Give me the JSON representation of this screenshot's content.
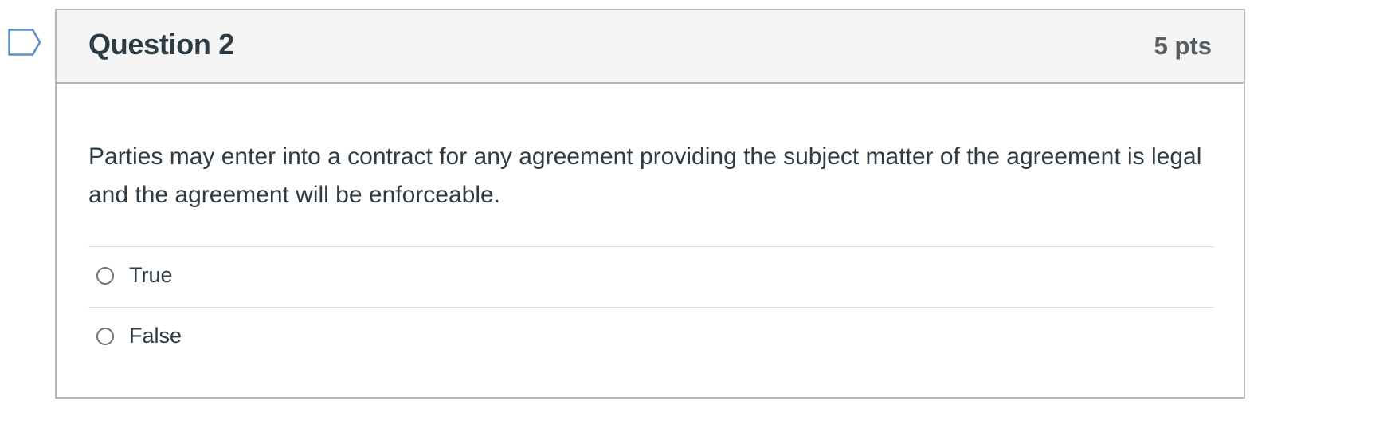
{
  "question": {
    "title": "Question 2",
    "points": "5 pts",
    "text": "Parties may enter into a contract for any agreement providing the subject matter of the agreement is legal and the agreement will be enforceable.",
    "flag_icon": "flag-icon"
  },
  "answers": [
    {
      "label": "True",
      "selected": false
    },
    {
      "label": "False",
      "selected": false
    }
  ],
  "colors": {
    "header_bg": "#f5f5f5",
    "border": "#b4b8bb",
    "text": "#2d3b45",
    "points_text": "#565e63",
    "flag_outline": "#5b8fc7"
  }
}
